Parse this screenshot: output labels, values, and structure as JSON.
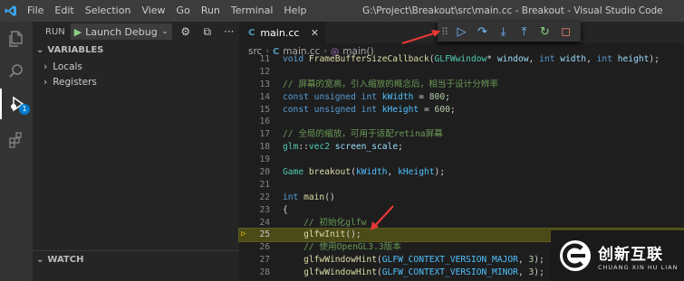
{
  "window": {
    "menu": [
      "File",
      "Edit",
      "Selection",
      "View",
      "Go",
      "Run",
      "Terminal",
      "Help"
    ],
    "title": "G:\\Project\\Breakout\\src\\main.cc - Breakout - Visual Studio Code"
  },
  "activity_bar": {
    "items": [
      "explorer-icon",
      "search-icon",
      "run-debug-icon",
      "extensions-icon"
    ],
    "debug_badge": "1"
  },
  "sidebar": {
    "run_title": "RUN",
    "launch_config": "Launch Debug",
    "more": "···",
    "variables_title": "VARIABLES",
    "variables": [
      "Locals",
      "Registers"
    ],
    "watch_title": "WATCH"
  },
  "editor": {
    "tab_icon": "C",
    "tab_label": "main.cc",
    "breadcrumb": {
      "folder": "src",
      "file": "main.cc",
      "symbol": "main()"
    },
    "current_line": 25,
    "lines": [
      {
        "n": "11",
        "html": "<span class=\"kw\">void</span> <span class=\"fn\">FrameBufferSizeCallback</span>(<span class=\"ty\">GLFWwindow</span>* <span class=\"var\">window</span>, <span class=\"kw\">int</span> <span class=\"var\">width</span>, <span class=\"kw\">int</span> <span class=\"var\">height</span>);"
      },
      {
        "n": "12",
        "html": ""
      },
      {
        "n": "13",
        "html": "<span class=\"cm\">// 屏幕的宽高，引入缩放的概念后，相当于设计分辨率</span>"
      },
      {
        "n": "14",
        "html": "<span class=\"kw\">const</span> <span class=\"kw\">unsigned</span> <span class=\"kw\">int</span> <span class=\"cst\">kWidth</span> = <span class=\"num\">800</span>;"
      },
      {
        "n": "15",
        "html": "<span class=\"kw\">const</span> <span class=\"kw\">unsigned</span> <span class=\"kw\">int</span> <span class=\"cst\">kHeight</span> = <span class=\"num\">600</span>;"
      },
      {
        "n": "16",
        "html": ""
      },
      {
        "n": "17",
        "html": "<span class=\"cm\">// 全局的缩放，可用于适配retina屏幕</span>"
      },
      {
        "n": "18",
        "html": "<span class=\"ty\">glm</span>::<span class=\"ty\">vec2</span> <span class=\"var\">screen_scale</span>;"
      },
      {
        "n": "19",
        "html": ""
      },
      {
        "n": "20",
        "html": "<span class=\"ty\">Game</span> <span class=\"fn\">breakout</span>(<span class=\"cst\">kWidth</span>, <span class=\"cst\">kHeight</span>);"
      },
      {
        "n": "21",
        "html": ""
      },
      {
        "n": "22",
        "html": "<span class=\"kw\">int</span> <span class=\"fn\">main</span>()"
      },
      {
        "n": "23",
        "html": "{"
      },
      {
        "n": "24",
        "html": "    <span class=\"cm\">// 初始化glfw</span>"
      },
      {
        "n": "25",
        "html": "    <span class=\"fn\">glfwInit</span>();"
      },
      {
        "n": "26",
        "html": "    <span class=\"cm\">// 使用OpenGL3.3版本</span>"
      },
      {
        "n": "27",
        "html": "    <span class=\"fn\">glfwWindowHint</span>(<span class=\"cst\">GLFW_CONTEXT_VERSION_MAJOR</span>, <span class=\"num\">3</span>);"
      },
      {
        "n": "28",
        "html": "    <span class=\"fn\">glfwWindowHint</span>(<span class=\"cst\">GLFW_CONTEXT_VERSION_MINOR</span>, <span class=\"num\">3</span>);"
      }
    ]
  },
  "debug_toolbar": [
    "drag-grip-icon",
    "continue-icon",
    "step-over-icon",
    "step-into-icon",
    "step-out-icon",
    "restart-icon",
    "stop-icon"
  ],
  "watermark": {
    "main": "创新互联",
    "sub": "CHUANG XIN HU LIAN"
  },
  "colors": {
    "accent": "#007acc",
    "annotation": "#e53935",
    "current_line": "#4b4b18"
  }
}
